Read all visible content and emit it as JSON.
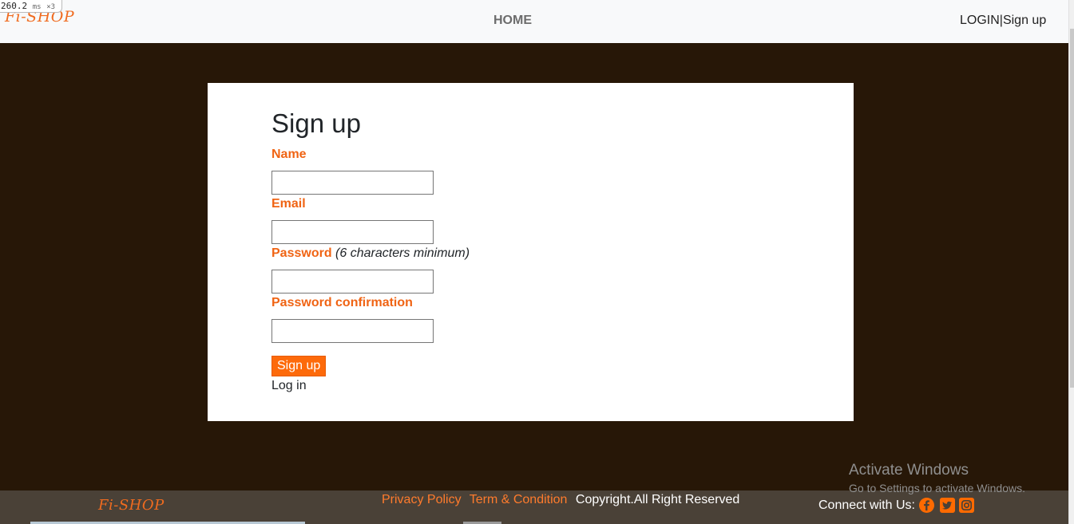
{
  "devtools": {
    "timer_value": "260.2",
    "timer_unit": "ms",
    "timer_mult": "×3"
  },
  "navbar": {
    "brand": "Fi-SHOP",
    "home": "HOME",
    "auth": "LOGIN|Sign up"
  },
  "form": {
    "title": "Sign up",
    "name_label": "Name",
    "name_value": "",
    "email_label": "Email",
    "email_value": "",
    "password_label": "Password",
    "password_hint": "(6 characters minimum)",
    "password_value": "",
    "confirm_label": "Password confirmation",
    "confirm_value": "",
    "submit": "Sign up",
    "login_link": "Log in"
  },
  "footer": {
    "brand": "Fi-SHOP",
    "privacy": "Privacy Policy",
    "terms": "Term & Condition",
    "copyright": "Copyright.All Right Reserved",
    "connect": "Connect with Us:",
    "social_icons": [
      "facebook-icon",
      "twitter-icon",
      "instagram-icon"
    ]
  },
  "watermark": {
    "title": "Activate Windows",
    "subtitle": "Go to Settings to activate Windows."
  },
  "colors": {
    "accent": "#f06414",
    "button": "#fd6a0a",
    "page_bg": "#271707",
    "footer_bg": "#4a4137",
    "social": "#ff6a00"
  }
}
